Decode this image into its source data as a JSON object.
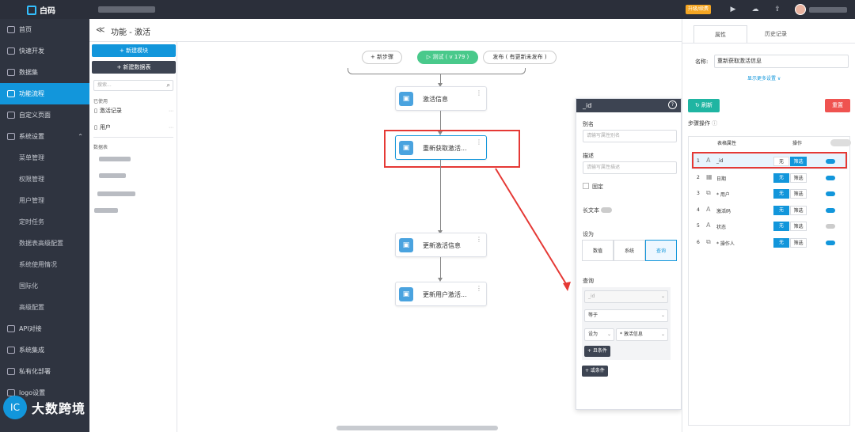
{
  "app": {
    "name": "白码",
    "upgrade": "升级/续费"
  },
  "sidebar": {
    "items": [
      {
        "label": "首页",
        "active": false
      },
      {
        "label": "快速开发",
        "active": false
      },
      {
        "label": "数据集",
        "active": false
      },
      {
        "label": "功能流程",
        "active": true
      },
      {
        "label": "自定义页面",
        "active": false
      },
      {
        "label": "系统设置",
        "active": false,
        "expandable": true
      }
    ],
    "subitems": [
      "菜单管理",
      "权限管理",
      "用户管理",
      "定时任务",
      "数据表高级配置",
      "系统使用情况",
      "国际化",
      "高级配置"
    ],
    "items2": [
      "API对接",
      "系统集成",
      "私有化部署",
      "logo设置"
    ],
    "brand": "大数跨境",
    "brand_logo": "IC"
  },
  "header": {
    "back": "≪",
    "title": "功能 - 激活"
  },
  "leftpanel": {
    "new_module": "+ 新建模块",
    "new_table": "+ 新建数据表",
    "search_placeholder": "搜索...",
    "used_label": "已使用",
    "used": [
      "激活记录",
      "用户"
    ],
    "tables_label": "数据表"
  },
  "flow": {
    "add_step": "+ 新步骤",
    "test": "▷ 测试 ( v 179 )",
    "publish": "发布 ( 有更新未发布 )",
    "nodes": [
      "激活信息",
      "重新获取激活...",
      "更新激活信息",
      "更新用户激活..."
    ]
  },
  "popover": {
    "title": "_id",
    "alias_label": "别名",
    "alias_placeholder": "请输写属性别名",
    "desc_label": "描述",
    "desc_placeholder": "请输写属性描述",
    "fixed_label": "固定",
    "longtext_label": "长文本",
    "setas_label": "设为",
    "setas_options": [
      "数值",
      "系统",
      "查询"
    ],
    "query_label": "查询",
    "query_field": "_id",
    "operator": "等于",
    "setas2": "设为",
    "target": "* 激活信息",
    "and_cond": "+ 且条件",
    "or_cond": "+ 或条件"
  },
  "right": {
    "tabs": [
      "属性",
      "历史记录"
    ],
    "name_label": "名称:",
    "name_value": "重新获取激活信息",
    "more_settings": "显示更多设置 ∨",
    "refresh": "刷新",
    "reset": "重置",
    "step_ops": "步骤操作",
    "col_attr": "表格属性",
    "col_op": "操作",
    "rows": [
      {
        "idx": "1",
        "icon": "text-icon",
        "name": "_id",
        "none": "无",
        "filter": "筛选",
        "none_active": false,
        "filter_active": true,
        "on": true
      },
      {
        "idx": "2",
        "icon": "date-icon",
        "name": "日期",
        "none": "无",
        "filter": "筛选",
        "none_active": true,
        "filter_active": false,
        "on": true
      },
      {
        "idx": "3",
        "icon": "user-icon",
        "name": "* 用户",
        "none": "无",
        "filter": "筛选",
        "none_active": true,
        "filter_active": false,
        "on": true
      },
      {
        "idx": "4",
        "icon": "text-icon",
        "name": "激活码",
        "none": "无",
        "filter": "筛选",
        "none_active": true,
        "filter_active": false,
        "on": true
      },
      {
        "idx": "5",
        "icon": "text-icon",
        "name": "状态",
        "none": "无",
        "filter": "筛选",
        "none_active": true,
        "filter_active": false,
        "on": false
      },
      {
        "idx": "6",
        "icon": "user-icon",
        "name": "* 操作人",
        "none": "无",
        "filter": "筛选",
        "none_active": true,
        "filter_active": false,
        "on": true
      }
    ]
  },
  "colors": {
    "accent": "#1296db",
    "green": "#49c98b",
    "red": "#e53935",
    "dark": "#2f3440"
  }
}
